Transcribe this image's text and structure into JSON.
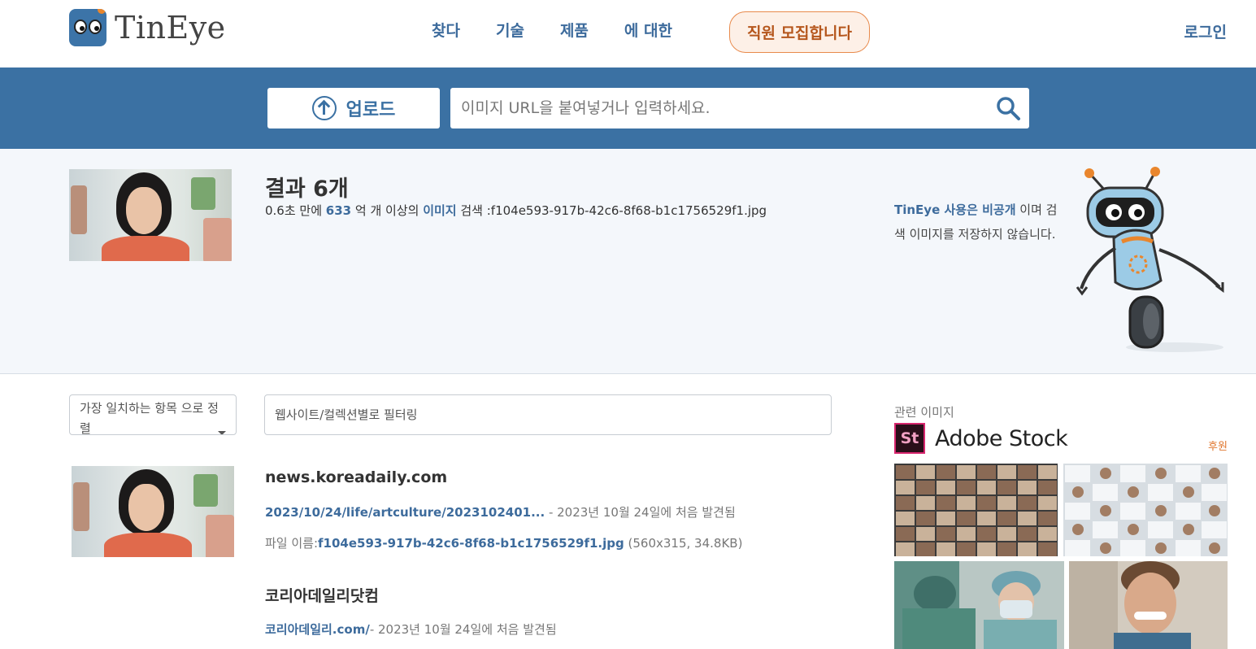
{
  "header": {
    "logo_text": "TinEye",
    "nav": [
      "찾다",
      "기술",
      "제품",
      "에 대한"
    ],
    "hiring_label": "직원 모집합니다",
    "login_label": "로그인"
  },
  "search": {
    "upload_label": "업로드",
    "placeholder": "이미지 URL을 붙여넣거나 입력하세요."
  },
  "summary": {
    "title": "결과 6개",
    "time": "0.6초 만에 ",
    "count": "633",
    "mid": " 억 개 이상의 ",
    "images_link": "이미지",
    "tail": " 검색 :f104e593-917b-42c6-8f68-b1c1756529f1.jpg",
    "privacy_link": "TinEye 사용은 비공개",
    "privacy_text": " 이며 검색 이미지를 저장하지 않습니다."
  },
  "controls": {
    "sort_label": "가장 일치하는 항목 으로 정렬",
    "filter_placeholder": "웹사이트/컬렉션별로 필터링"
  },
  "results": [
    {
      "domain": "news.koreadaily.com",
      "path": "2023/10/24/life/artculture/2023102401...",
      "found": " - 2023년 10월 24일에 처음 발견됨",
      "file_prefix": "파일 이름:",
      "file_name": "f104e593-917b-42c6-8f68-b1c1756529f1.jpg",
      "file_meta": " (560x315, 34.8KB)"
    },
    {
      "domain": "코리아데일리닷컴",
      "path": "코리아데일리.com/",
      "found": "- 2023년 10월 24일에 처음 발견됨"
    }
  ],
  "related": {
    "heading": "관련 이미지",
    "brand_badge": "St",
    "brand_name": "Adobe Stock",
    "sponsor_label": "후원"
  },
  "colors": {
    "brand_blue": "#3b71a3",
    "link_blue": "#3d6b9c",
    "hiring_orange": "#e88a4c"
  }
}
